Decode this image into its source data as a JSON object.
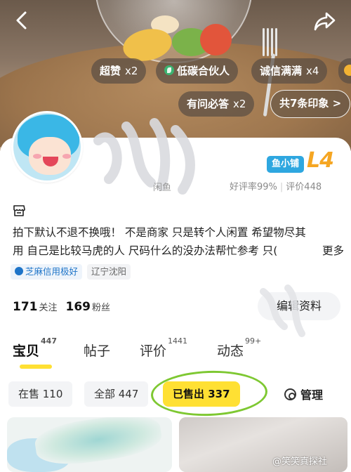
{
  "header": {
    "badges": [
      {
        "label": "超赞",
        "count": "x2"
      },
      {
        "label": "低碳合伙人",
        "count": ""
      },
      {
        "label": "诚信满满",
        "count": "x4"
      },
      {
        "label": "有问必答",
        "count": "x2"
      }
    ],
    "impressions_label": "共7条印象 >",
    "back_icon": "back-arrow-icon",
    "share_icon": "share-icon"
  },
  "profile": {
    "shop_badge": "鱼小铺",
    "shop_level": "L4",
    "app_tag": "闲鱼",
    "rating": {
      "good": "好评率99%",
      "reviews": "评价448"
    },
    "bio_lines": [
      "拍下默认不退不换哦！ 不是商家 只是转个人闲置 希望物尽其",
      "用 自己是比较马虎的人 尺码什么的没办法帮忙参考   只("
    ],
    "bio_more": "更多",
    "tags": {
      "credit": "芝麻信用极好",
      "location": "辽宁沈阳"
    },
    "stats": {
      "following_count": "171",
      "following_label": "关注",
      "followers_count": "169",
      "followers_label": "粉丝"
    },
    "edit_label": "编辑资料"
  },
  "tabs": [
    {
      "label": "宝贝",
      "count": "447",
      "active": true
    },
    {
      "label": "帖子",
      "count": "",
      "active": false
    },
    {
      "label": "评价",
      "count": "1441",
      "active": false
    },
    {
      "label": "动态",
      "count": "99+",
      "active": false
    }
  ],
  "filters": {
    "on_sale": "在售 110",
    "all": "全部 447",
    "sold": "已售出 337",
    "manage": "管理"
  },
  "watermark": "@笑笑真探社",
  "colors": {
    "accent_yellow": "#ffe033",
    "highlight_ring": "#7ec832",
    "level_orange": "#f5a623",
    "shop_blue": "#2ea7e0"
  }
}
